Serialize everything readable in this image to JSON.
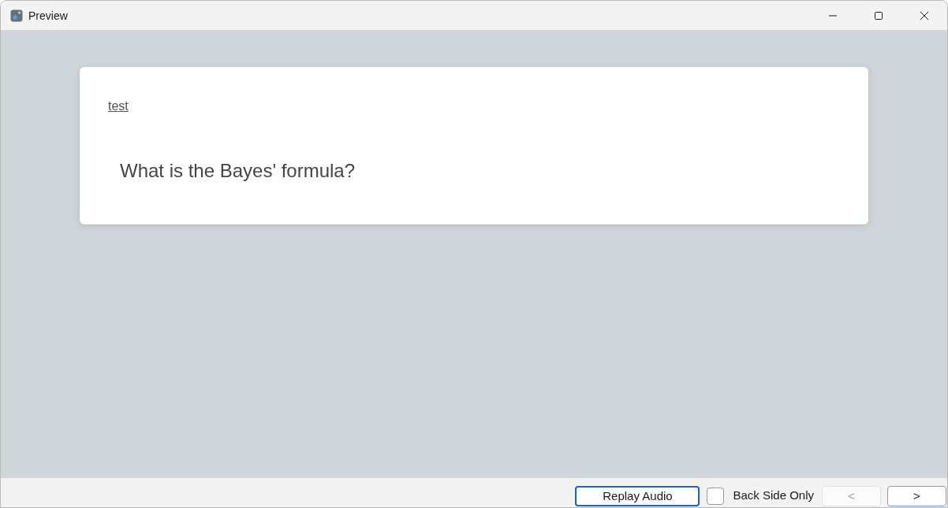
{
  "window": {
    "title": "Preview"
  },
  "card": {
    "tag": "test",
    "question": "What is the Bayes' formula?"
  },
  "controls": [
    {
      "kind": "button",
      "label": "Replay Audio",
      "focused": true,
      "default": false,
      "disabled": false
    },
    {
      "kind": "checkbox",
      "label": "Back Side Only",
      "checked": false
    },
    {
      "kind": "button",
      "label": "<",
      "focused": false,
      "default": false,
      "disabled": true
    },
    {
      "kind": "button",
      "label": ">",
      "focused": false,
      "default": true,
      "disabled": false
    }
  ]
}
